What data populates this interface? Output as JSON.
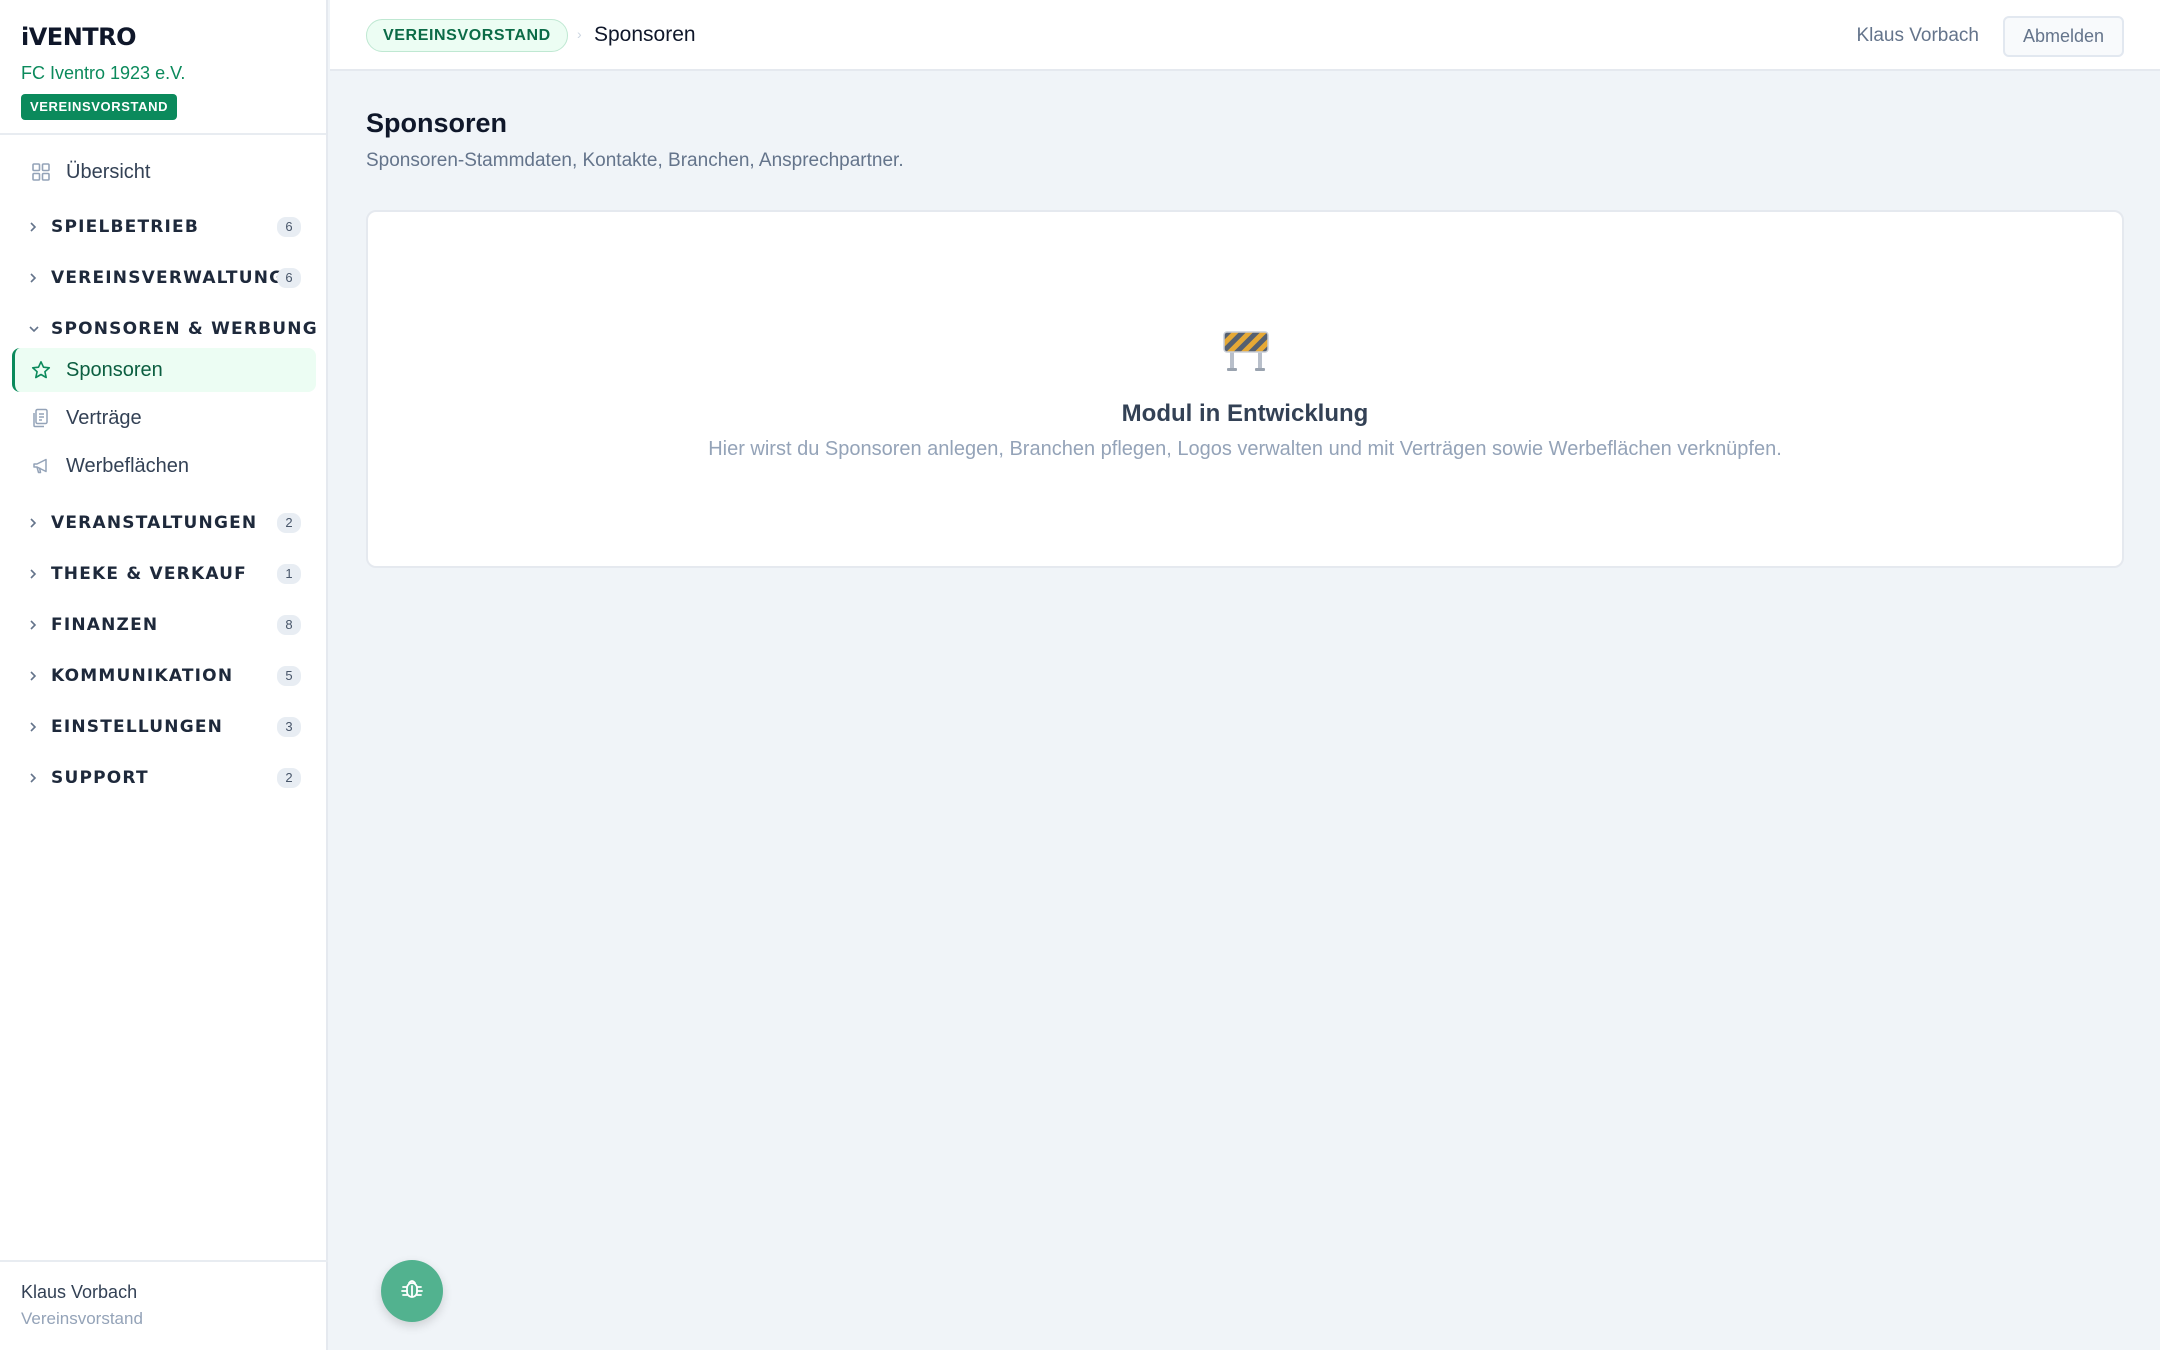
{
  "brand": {
    "title": "iVENTRO",
    "club": "FC Iventro 1923 e.V.",
    "role_badge": "VEREINSVORSTAND"
  },
  "nav": {
    "overview": "Übersicht",
    "groups": [
      {
        "label": "SPIELBETRIEB",
        "count": "6"
      },
      {
        "label": "VEREINSVERWALTUNG",
        "count": "6"
      },
      {
        "label": "SPONSOREN & WERBUNG",
        "count": ""
      },
      {
        "label": "VERANSTALTUNGEN",
        "count": "2"
      },
      {
        "label": "THEKE & VERKAUF",
        "count": "1"
      },
      {
        "label": "FINANZEN",
        "count": "8"
      },
      {
        "label": "KOMMUNIKATION",
        "count": "5"
      },
      {
        "label": "EINSTELLUNGEN",
        "count": "3"
      },
      {
        "label": "SUPPORT",
        "count": "2"
      }
    ],
    "sponsor_items": [
      {
        "label": "Sponsoren",
        "icon": "star-icon",
        "active": true
      },
      {
        "label": "Verträge",
        "icon": "document-icon",
        "active": false
      },
      {
        "label": "Werbeflächen",
        "icon": "megaphone-icon",
        "active": false
      }
    ]
  },
  "footer": {
    "name": "Klaus Vorbach",
    "role": "Vereinsvorstand"
  },
  "topbar": {
    "role_badge": "VEREINSVORSTAND",
    "separator": "›",
    "current": "Sponsoren",
    "user": "Klaus Vorbach",
    "logout": "Abmelden"
  },
  "page": {
    "title": "Sponsoren",
    "subtitle": "Sponsoren-Stammdaten, Kontakte, Branchen, Ansprechpartner."
  },
  "card": {
    "icon": "construction-icon",
    "title": "Modul in Entwicklung",
    "text": "Hier wirst du Sponsoren anlegen, Branchen pflegen, Logos verwalten und mit Verträgen sowie Werbeflächen verknüpfen."
  },
  "colors": {
    "accent": "#0b8a5c",
    "fab": "#52b28f"
  }
}
